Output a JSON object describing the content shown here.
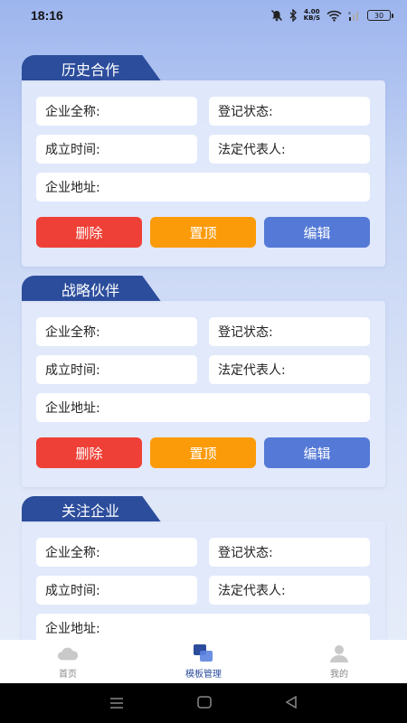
{
  "status": {
    "time": "18:16",
    "speed_value": "4.00",
    "speed_unit": "KB/S",
    "battery": "30"
  },
  "cards": [
    {
      "title": "历史合作",
      "fields": {
        "company_name": "企业全称:",
        "reg_status": "登记状态:",
        "found_date": "成立时间:",
        "legal_rep": "法定代表人:",
        "address": "企业地址:"
      },
      "buttons": {
        "delete": "删除",
        "pin": "置顶",
        "edit": "编辑"
      }
    },
    {
      "title": "战略伙伴",
      "fields": {
        "company_name": "企业全称:",
        "reg_status": "登记状态:",
        "found_date": "成立时间:",
        "legal_rep": "法定代表人:",
        "address": "企业地址:"
      },
      "buttons": {
        "delete": "删除",
        "pin": "置顶",
        "edit": "编辑"
      }
    },
    {
      "title": "关注企业",
      "fields": {
        "company_name": "企业全称:",
        "reg_status": "登记状态:",
        "found_date": "成立时间:",
        "legal_rep": "法定代表人:",
        "address": "企业地址:"
      }
    }
  ],
  "tabbar": {
    "home": "首页",
    "templates": "模板管理",
    "mine": "我的"
  },
  "colors": {
    "accent": "#2c4d9c",
    "delete": "#ee4036",
    "pin": "#fb9b09",
    "edit": "#5479d6"
  }
}
